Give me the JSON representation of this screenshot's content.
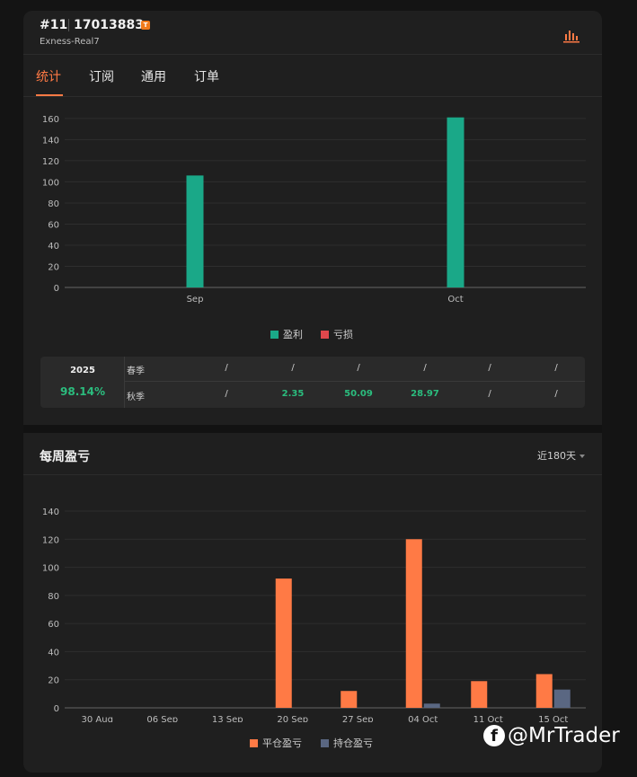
{
  "header": {
    "rank": "#11",
    "account": "17013883",
    "badge": "T",
    "server": "Exness-Real7",
    "chart_icon": "bar-chart-icon"
  },
  "tabs": [
    {
      "label": "统计",
      "active": true
    },
    {
      "label": "订阅",
      "active": false
    },
    {
      "label": "通用",
      "active": false
    },
    {
      "label": "订单",
      "active": false
    }
  ],
  "legend_monthly": [
    {
      "label": "盈利",
      "color": "#1aa888"
    },
    {
      "label": "亏损",
      "color": "#e0474c"
    }
  ],
  "seasons": {
    "year": "2025",
    "year_pct": "98.14%",
    "rows": [
      {
        "name": "春季",
        "values": [
          "/",
          "/",
          "/",
          "/",
          "/",
          "/"
        ]
      },
      {
        "name": "秋季",
        "values": [
          "/",
          "2.35",
          "50.09",
          "28.97",
          "/",
          "/"
        ]
      }
    ]
  },
  "weekly": {
    "title": "每周盈亏",
    "range": "近180天",
    "legend": [
      {
        "label": "平仓盈亏",
        "color": "#ff7a45"
      },
      {
        "label": "持仓盈亏",
        "color": "#5a6782"
      }
    ]
  },
  "watermark": "@MrTrader",
  "chart_data": [
    {
      "type": "bar",
      "categories": [
        "Sep",
        "Oct"
      ],
      "series": [
        {
          "name": "盈利",
          "values": [
            106,
            161
          ],
          "color": "#1aa888"
        },
        {
          "name": "亏损",
          "values": [
            0,
            0
          ],
          "color": "#e0474c"
        }
      ],
      "yticks": [
        0,
        20,
        40,
        60,
        80,
        100,
        120,
        140,
        160
      ],
      "ylim": [
        0,
        165
      ],
      "grid": true,
      "legend": "bottom-center"
    },
    {
      "type": "bar",
      "categories": [
        "30 Aug",
        "06 Sep",
        "13 Sep",
        "20 Sep",
        "27 Sep",
        "04 Oct",
        "11 Oct",
        "15 Oct"
      ],
      "series": [
        {
          "name": "平仓盈亏",
          "values": [
            0,
            0,
            0,
            92,
            12,
            120,
            19,
            24
          ],
          "color": "#ff7a45"
        },
        {
          "name": "持仓盈亏",
          "values": [
            0,
            0,
            0,
            0,
            0,
            3,
            0,
            13
          ],
          "color": "#5a6782"
        }
      ],
      "yticks": [
        0,
        20,
        40,
        60,
        80,
        100,
        120,
        140
      ],
      "ylim": [
        0,
        140
      ],
      "grid": true,
      "legend": "bottom-center"
    }
  ]
}
